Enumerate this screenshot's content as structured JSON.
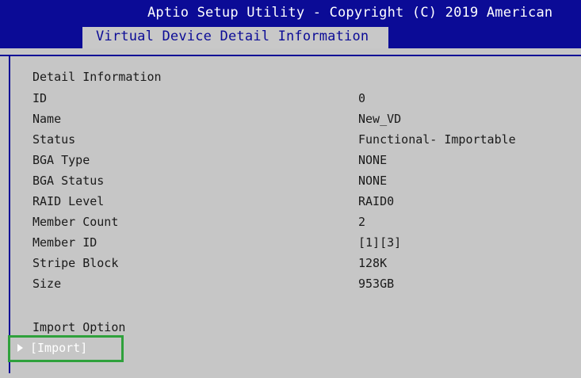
{
  "header": {
    "title": "Aptio Setup Utility - Copyright (C) 2019 American",
    "tab": "Virtual Device Detail Information"
  },
  "detail": {
    "section_title": "Detail Information",
    "rows": [
      {
        "label": "ID",
        "value": "0"
      },
      {
        "label": "Name",
        "value": "New_VD"
      },
      {
        "label": "Status",
        "value": "Functional- Importable"
      },
      {
        "label": "BGA Type",
        "value": "NONE"
      },
      {
        "label": "BGA Status",
        "value": "NONE"
      },
      {
        "label": "RAID Level",
        "value": "RAID0"
      },
      {
        "label": "Member Count",
        "value": "2"
      },
      {
        "label": "Member ID",
        "value": "[1][3]"
      },
      {
        "label": "Stripe Block",
        "value": "128K"
      },
      {
        "label": "Size",
        "value": "953GB"
      }
    ]
  },
  "import": {
    "section_title": "Import Option",
    "action_label": "[Import]"
  },
  "colors": {
    "header_bg": "#0b0b96",
    "panel_bg": "#c6c6c6",
    "highlight_border": "#2fa13c"
  }
}
